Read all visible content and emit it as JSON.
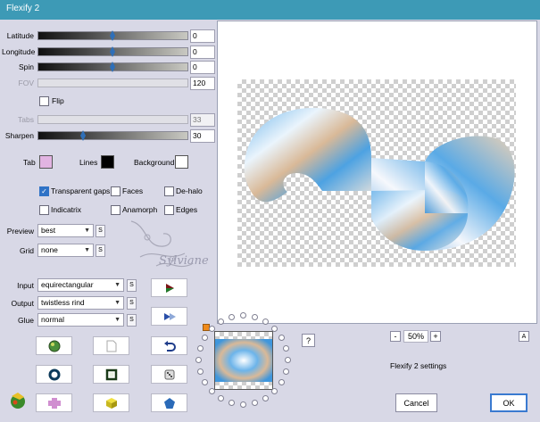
{
  "window": {
    "title": "Flexify 2"
  },
  "sliders": {
    "latitude": {
      "label": "Latitude",
      "value": "0",
      "pos": 0.5
    },
    "longitude": {
      "label": "Longitude",
      "value": "0",
      "pos": 0.5
    },
    "spin": {
      "label": "Spin",
      "value": "0",
      "pos": 0.5
    },
    "fov": {
      "label": "FOV",
      "value": "120"
    },
    "tabs": {
      "label": "Tabs",
      "value": "33"
    },
    "sharpen": {
      "label": "Sharpen",
      "value": "30",
      "pos": 0.3
    }
  },
  "flip": {
    "label": "Flip",
    "checked": false
  },
  "colors": {
    "tab": {
      "label": "Tab",
      "color": "#e2b4e2"
    },
    "lines": {
      "label": "Lines",
      "color": "#000000"
    },
    "background": {
      "label": "Background",
      "color": "#ffffff"
    }
  },
  "checkboxes": {
    "transparent_gaps": {
      "label": "Transparent gaps",
      "checked": true
    },
    "faces": {
      "label": "Faces",
      "checked": false
    },
    "de_halo": {
      "label": "De-halo",
      "checked": false
    },
    "indicatrix": {
      "label": "Indicatrix",
      "checked": false
    },
    "anamorph": {
      "label": "Anamorph",
      "checked": false
    },
    "edges": {
      "label": "Edges",
      "checked": false
    }
  },
  "selects": {
    "preview": {
      "label": "Preview",
      "value": "best"
    },
    "grid": {
      "label": "Grid",
      "value": "none"
    },
    "input": {
      "label": "Input",
      "value": "equirectangular"
    },
    "output": {
      "label": "Output",
      "value": "twistless rind"
    },
    "glue": {
      "label": "Glue",
      "value": "normal"
    }
  },
  "s_button_label": "S",
  "watermark": "Sylviane",
  "zoom": {
    "minus": "-",
    "value": "50%",
    "plus": "+",
    "a": "A"
  },
  "help_label": "?",
  "status": "Flexify 2 settings",
  "buttons": {
    "cancel": "Cancel",
    "ok": "OK"
  },
  "accent_colors": {
    "titlebar": "#3d9ab6",
    "checkbox": "#2f72c6",
    "slider_thumb": "#2f6fb8"
  }
}
